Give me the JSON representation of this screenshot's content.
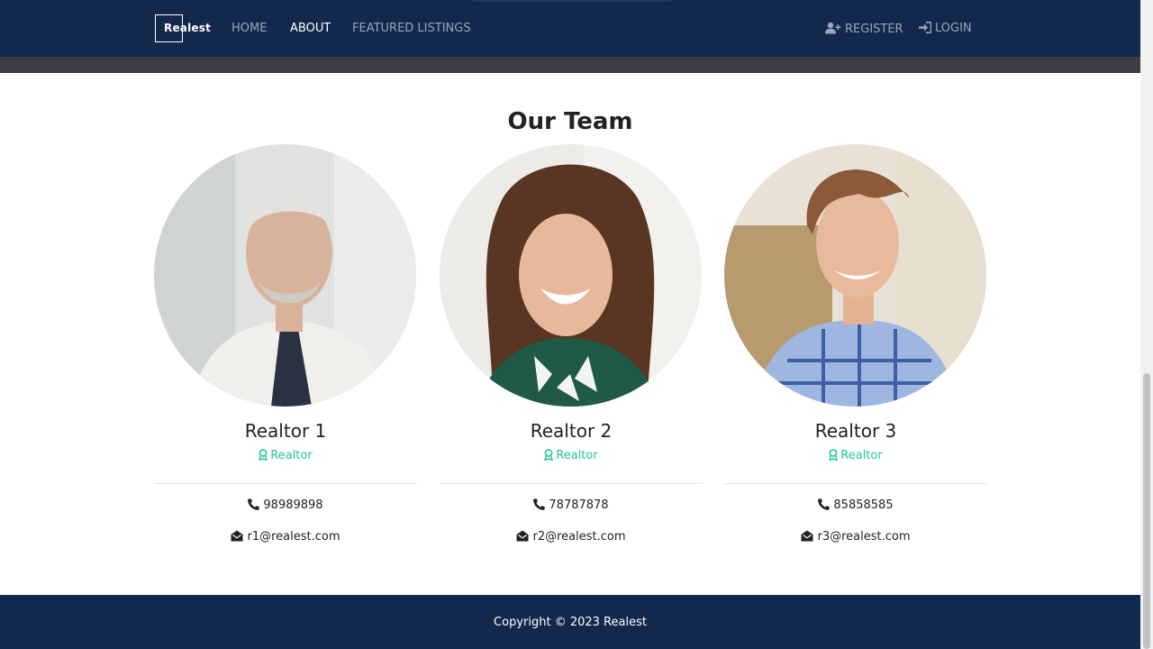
{
  "nav": {
    "brand": "Realest",
    "links": [
      {
        "label": "HOME",
        "active": false
      },
      {
        "label": "ABOUT",
        "active": true
      },
      {
        "label": "FEATURED LISTINGS",
        "active": false
      }
    ],
    "register": "REGISTER",
    "login": "LOGIN"
  },
  "team": {
    "title": "Our Team",
    "members": [
      {
        "name": "Realtor 1",
        "role": "Realtor",
        "phone": "98989898",
        "email": "r1@realest.com"
      },
      {
        "name": "Realtor 2",
        "role": "Realtor",
        "phone": "78787878",
        "email": "r2@realest.com"
      },
      {
        "name": "Realtor 3",
        "role": "Realtor",
        "phone": "85858585",
        "email": "r3@realest.com"
      }
    ]
  },
  "footer": {
    "copyright": "Copyright © 2023 Realest"
  },
  "colors": {
    "navbar": "#12284c",
    "accent": "#20c997",
    "strip": "#3b3f42"
  },
  "icons": {
    "register": "user-plus-icon",
    "login": "sign-in-icon",
    "role": "award-icon",
    "phone": "phone-icon",
    "email": "envelope-open-icon"
  }
}
